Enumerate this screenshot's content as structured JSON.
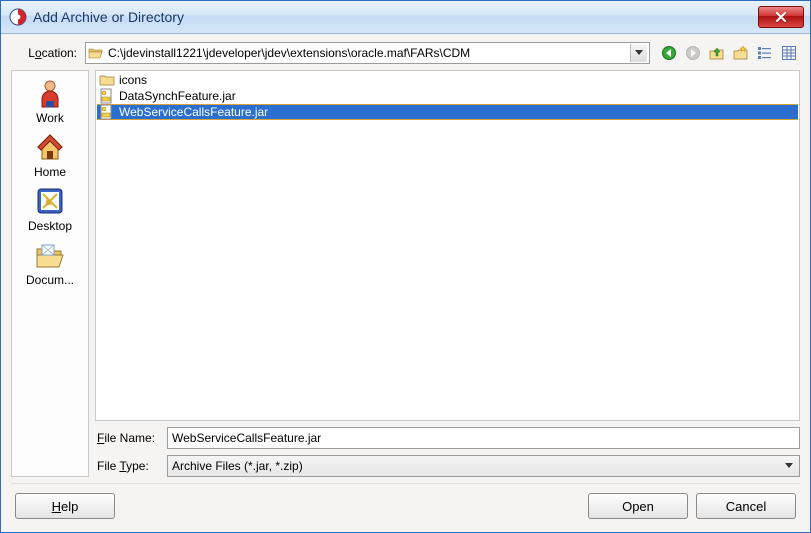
{
  "window": {
    "title": "Add Archive or Directory"
  },
  "location": {
    "label_pre": "L",
    "label_mn": "o",
    "label_post": "cation:",
    "path": "C:\\jdevinstall1221\\jdeveloper\\jdev\\extensions\\oracle.maf\\FARs\\CDM"
  },
  "places": [
    {
      "id": "work",
      "label": "Work",
      "icon": "person"
    },
    {
      "id": "home",
      "label": "Home",
      "icon": "house"
    },
    {
      "id": "desktop",
      "label": "Desktop",
      "icon": "desktop"
    },
    {
      "id": "docs",
      "label": "Docum...",
      "icon": "folder-open"
    }
  ],
  "files": [
    {
      "name": "icons",
      "type": "folder",
      "selected": false
    },
    {
      "name": "DataSynchFeature.jar",
      "type": "jar",
      "selected": false
    },
    {
      "name": "WebServiceCallsFeature.jar",
      "type": "jar",
      "selected": true
    }
  ],
  "filename": {
    "label_mn": "F",
    "label_post": "ile Name:",
    "value": "WebServiceCallsFeature.jar"
  },
  "filetype": {
    "label_pre": "File ",
    "label_mn": "T",
    "label_post": "ype:",
    "value": "Archive Files (*.jar, *.zip)"
  },
  "buttons": {
    "help_mn": "H",
    "help_post": "elp",
    "open": "Open",
    "cancel": "Cancel"
  }
}
